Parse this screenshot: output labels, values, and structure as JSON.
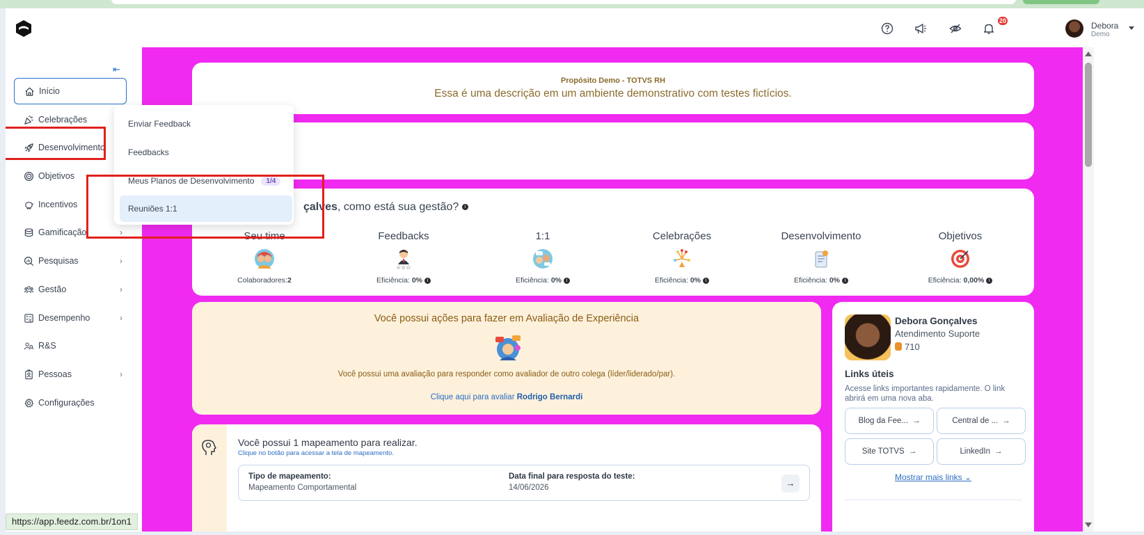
{
  "topbar": {
    "user_name": "Debora",
    "user_subtitle": "Demo",
    "notification_count": "20"
  },
  "sidebar": {
    "items": [
      {
        "label": "Início",
        "icon": "home-icon"
      },
      {
        "label": "Celebrações",
        "icon": "party-icon"
      },
      {
        "label": "Desenvolvimento",
        "icon": "rocket-icon"
      },
      {
        "label": "Objetivos",
        "icon": "target-icon"
      },
      {
        "label": "Incentivos",
        "icon": "piggy-bank-icon"
      },
      {
        "label": "Gamificação",
        "icon": "coins-icon"
      },
      {
        "label": "Pesquisas",
        "icon": "survey-icon"
      },
      {
        "label": "Gestão",
        "icon": "team-icon"
      },
      {
        "label": "Desempenho",
        "icon": "checklist-icon"
      },
      {
        "label": "R&S",
        "icon": "people-search-icon"
      },
      {
        "label": "Pessoas",
        "icon": "id-badge-icon"
      },
      {
        "label": "Configurações",
        "icon": "gear-icon"
      }
    ]
  },
  "submenu": {
    "items": [
      {
        "label": "Enviar Feedback"
      },
      {
        "label": "Feedbacks"
      },
      {
        "label": "Meus Planos de Desenvolvimento",
        "badge": "1/4"
      },
      {
        "label": "Reuniões 1:1"
      }
    ]
  },
  "purpose": {
    "title": "Propósito Demo - TOTVS RH",
    "description": "Essa é uma descrição em um ambiente demonstrativo com testes fictícios."
  },
  "gestao": {
    "name_fragment": "çalves",
    "question": ", como está sua gestão?",
    "stats": [
      {
        "label": "Seu time",
        "value_label": "Colaboradores:",
        "value": "2"
      },
      {
        "label": "Feedbacks",
        "value_label": "Eficiência: ",
        "value": "0%"
      },
      {
        "label": "1:1",
        "value_label": "Eficiência: ",
        "value": "0%"
      },
      {
        "label": "Celebrações",
        "value_label": "Eficiência: ",
        "value": "0%"
      },
      {
        "label": "Desenvolvimento",
        "value_label": "Eficiência: ",
        "value": "0%"
      },
      {
        "label": "Objetivos",
        "value_label": "Eficiência: ",
        "value": "0,00%"
      }
    ]
  },
  "experience": {
    "title": "Você possui ações para fazer em Avaliação de Experiência",
    "text": "Você possui uma avaliação para responder como avaliador de outro colega (líder/liderado/par).",
    "link_prefix": "Clique aqui para avaliar ",
    "link_name": "Rodrigo Bernardi"
  },
  "mapping": {
    "title": "Você possui 1 mapeamento para realizar.",
    "subtitle": "Clique no botão para acessar a tela de mapeamento.",
    "type_label": "Tipo de mapeamento:",
    "type_value": "Mapeamento Comportamental",
    "deadline_label": "Data final para resposta do teste:",
    "deadline_value": "14/06/2026"
  },
  "profile": {
    "name": "Debora Gonçalves",
    "role": "Atendimento Suporte",
    "coins": "710",
    "links_title": "Links úteis",
    "links_desc": "Acesse links importantes rapidamente. O link abrirá em uma nova aba.",
    "links": [
      {
        "label": "Blog da Fee..."
      },
      {
        "label": "Central de ..."
      },
      {
        "label": "Site TOTVS"
      },
      {
        "label": "LinkedIn"
      }
    ],
    "more_label": "Mostrar mais links"
  },
  "status_url": "https://app.feedz.com.br/1on1",
  "colors": {
    "accent": "#2d6ec4",
    "highlight": "#e0201c",
    "main_bg": "#f02af0"
  }
}
